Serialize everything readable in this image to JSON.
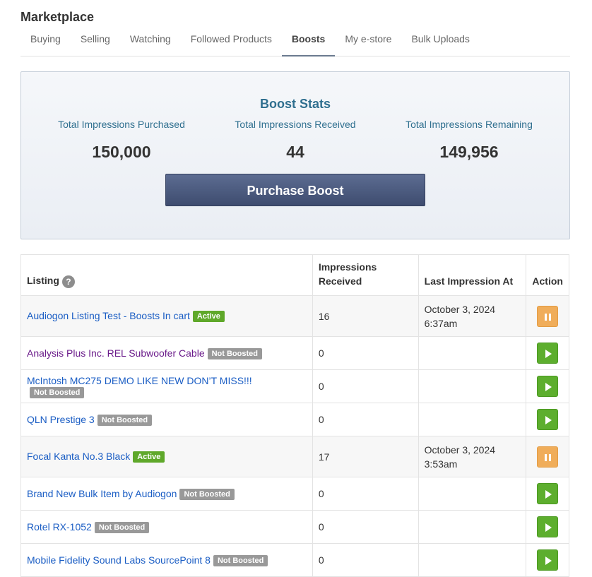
{
  "page": {
    "title": "Marketplace"
  },
  "tabs": [
    {
      "label": "Buying",
      "active": false
    },
    {
      "label": "Selling",
      "active": false
    },
    {
      "label": "Watching",
      "active": false
    },
    {
      "label": "Followed Products",
      "active": false
    },
    {
      "label": "Boosts",
      "active": true
    },
    {
      "label": "My e-store",
      "active": false
    },
    {
      "label": "Bulk Uploads",
      "active": false
    }
  ],
  "stats": {
    "title": "Boost Stats",
    "purchased_label": "Total Impressions Purchased",
    "purchased_value": "150,000",
    "received_label": "Total Impressions Received",
    "received_value": "44",
    "remaining_label": "Total Impressions Remaining",
    "remaining_value": "149,956",
    "purchase_button": "Purchase Boost"
  },
  "table": {
    "headers": {
      "listing": "Listing",
      "help_icon": "?",
      "impressions_line1": "Impressions",
      "impressions_line2": "Received",
      "last": "Last Impression At",
      "action": "Action"
    },
    "rows": [
      {
        "listing": "Audiogon Listing Test - Boosts In cart",
        "badge": "Active",
        "impressions": "16",
        "last_date": "October 3, 2024",
        "last_time": "6:37am",
        "action": "pause-icon"
      },
      {
        "listing": "Analysis Plus Inc. REL Subwoofer Cable",
        "badge": "Not Boosted",
        "impressions": "0",
        "last_date": "",
        "last_time": "",
        "action": "play-icon"
      },
      {
        "listing": "McIntosh MC275 DEMO LIKE NEW DON’T MISS!!!",
        "badge": "Not Boosted",
        "impressions": "0",
        "last_date": "",
        "last_time": "",
        "action": "play-icon"
      },
      {
        "listing": "QLN Prestige 3",
        "badge": "Not Boosted",
        "impressions": "0",
        "last_date": "",
        "last_time": "",
        "action": "play-icon"
      },
      {
        "listing": "Focal Kanta No.3 Black",
        "badge": "Active",
        "impressions": "17",
        "last_date": "October 3, 2024",
        "last_time": "3:53am",
        "action": "pause-icon"
      },
      {
        "listing": "Brand New Bulk Item by Audiogon",
        "badge": "Not Boosted",
        "impressions": "0",
        "last_date": "",
        "last_time": "",
        "action": "play-icon"
      },
      {
        "listing": "Rotel RX-1052",
        "badge": "Not Boosted",
        "impressions": "0",
        "last_date": "",
        "last_time": "",
        "action": "play-icon"
      },
      {
        "listing": "Mobile Fidelity Sound Labs SourcePoint 8",
        "badge": "Not Boosted",
        "impressions": "0",
        "last_date": "",
        "last_time": "",
        "action": "play-icon"
      }
    ]
  },
  "colors": {
    "accent": "#2f6f8f",
    "link": "#1a5dc4",
    "visited_link": "#6a1b8a",
    "active_badge": "#5fa82a",
    "inactive_badge": "#999999",
    "play_button": "#5dae2e",
    "pause_button": "#f0ad5a",
    "purchase_button": "#4a5a80"
  }
}
